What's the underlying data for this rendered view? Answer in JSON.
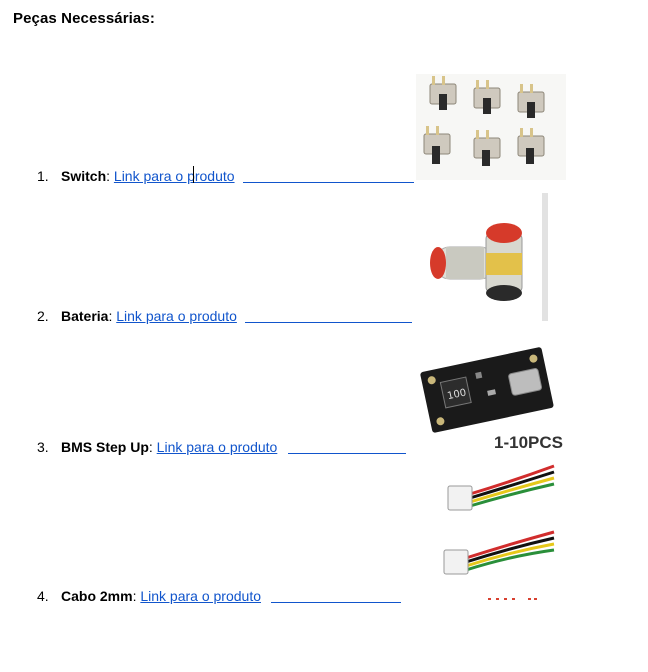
{
  "heading": "Peças Necessárias:",
  "items": [
    {
      "number": "1.",
      "name": "Switch",
      "separator": ": ",
      "link_text": "Link para o produto",
      "image": "slide-switch-photo"
    },
    {
      "number": "2.",
      "name": "Bateria",
      "separator": ": ",
      "link_text": "Link para o produto",
      "image": "lipo-battery-photo"
    },
    {
      "number": "3.",
      "name": "BMS Step Up",
      "separator": ": ",
      "link_text": "Link para o produto",
      "image": "bms-board-photo",
      "image_caption": "1-10PCS",
      "chip_marking": "100"
    },
    {
      "number": "4.",
      "name": "Cabo 2mm",
      "separator": ": ",
      "link_text": "Link para o produto",
      "image": "jst-cable-photo"
    }
  ],
  "colors": {
    "link": "#1155cc",
    "text": "#000000"
  }
}
